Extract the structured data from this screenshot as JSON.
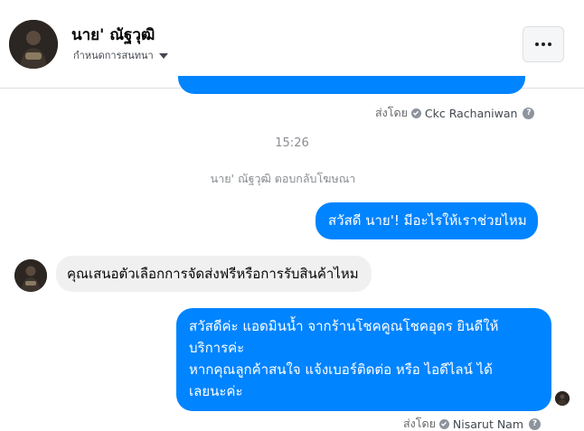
{
  "header": {
    "name": "นาย' ณัฐวุฒิ",
    "subtitle": "กำหนดการสนทนา",
    "more_icon": "more-horizontal-icon"
  },
  "messages": {
    "sent_by_1": {
      "prefix": "ส่งโดย",
      "name": "Ckc Rachaniwan"
    },
    "timestamp": "15:26",
    "system": "นาย' ณัฐวุฒิ ตอบกลับโฆษณา",
    "outgoing_1": "สวัสดี นาย'! มีอะไรให้เราช่วยไหม",
    "incoming_1": "คุณเสนอตัวเลือกการจัดส่งฟรีหรือการรับสินค้าไหม",
    "outgoing_2": {
      "line1": "สวัสดีค่ะ แอดมินน้ำ จากร้านโชคคูณโชคอุดร ยินดีให้",
      "line2": "บริการค่ะ",
      "line3": "หากคุณลูกค้าสนใจ แจ้งเบอร์ติดต่อ หรือ ไอดีไลน์ ได้",
      "line4": "เลยนะค่ะ"
    },
    "sent_by_2": {
      "prefix": "ส่งโดย",
      "name": "Nisarut Nam"
    }
  },
  "colors": {
    "outgoing_bubble": "#0084ff",
    "incoming_bubble": "#f0f0f0"
  }
}
